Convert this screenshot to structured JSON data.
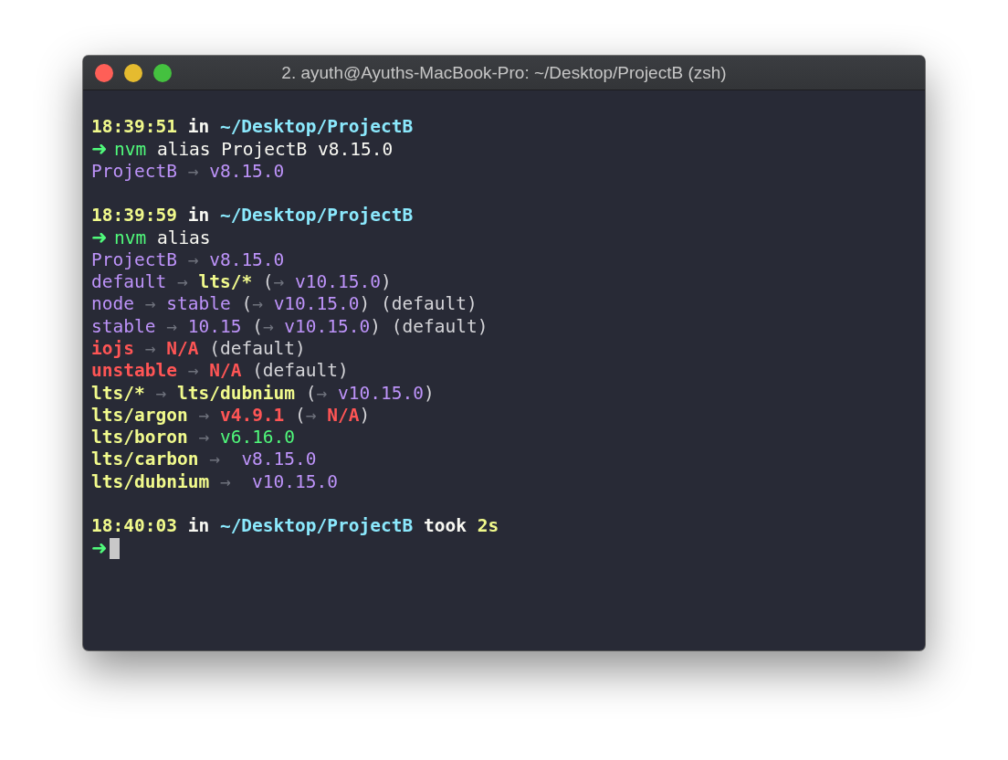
{
  "window": {
    "title": "2. ayuth@Ayuths-MacBook-Pro: ~/Desktop/ProjectB (zsh)"
  },
  "blocks": [
    {
      "lines": [
        [
          {
            "text": "18:39:51",
            "kind": "time"
          },
          {
            "text": " in ",
            "kind": "bold"
          },
          {
            "text": "~/Desktop/ProjectB",
            "kind": "path"
          }
        ],
        [
          {
            "text": "➜ ",
            "kind": "prompt"
          },
          {
            "text": "nvm",
            "kind": "cmd"
          },
          {
            "text": " alias ProjectB v8.15.0",
            "kind": "plain"
          }
        ],
        [
          {
            "text": "ProjectB",
            "kind": "alias"
          },
          {
            "text": " → ",
            "kind": "arrow"
          },
          {
            "text": "v8.15.0",
            "kind": "alias"
          }
        ]
      ]
    },
    {
      "lines": [
        [
          {
            "text": "18:39:59",
            "kind": "time"
          },
          {
            "text": " in ",
            "kind": "bold"
          },
          {
            "text": "~/Desktop/ProjectB",
            "kind": "path"
          }
        ],
        [
          {
            "text": "➜ ",
            "kind": "prompt"
          },
          {
            "text": "nvm",
            "kind": "cmd"
          },
          {
            "text": " alias",
            "kind": "plain"
          }
        ],
        [
          {
            "text": "ProjectB",
            "kind": "alias"
          },
          {
            "text": " → ",
            "kind": "arrow"
          },
          {
            "text": "v8.15.0",
            "kind": "alias"
          }
        ],
        [
          {
            "text": "default",
            "kind": "alias"
          },
          {
            "text": " → ",
            "kind": "arrow"
          },
          {
            "text": "lts/*",
            "kind": "lts"
          },
          {
            "text": " (",
            "kind": "muted"
          },
          {
            "text": "→ ",
            "kind": "arrow"
          },
          {
            "text": "v10.15.0",
            "kind": "alias"
          },
          {
            "text": ")",
            "kind": "muted"
          }
        ],
        [
          {
            "text": "node",
            "kind": "alias"
          },
          {
            "text": " → ",
            "kind": "arrow"
          },
          {
            "text": "stable",
            "kind": "alias"
          },
          {
            "text": " (",
            "kind": "muted"
          },
          {
            "text": "→ ",
            "kind": "arrow"
          },
          {
            "text": "v10.15.0",
            "kind": "alias"
          },
          {
            "text": ") (default)",
            "kind": "muted"
          }
        ],
        [
          {
            "text": "stable",
            "kind": "alias"
          },
          {
            "text": " → ",
            "kind": "arrow"
          },
          {
            "text": "10.15",
            "kind": "alias"
          },
          {
            "text": " (",
            "kind": "muted"
          },
          {
            "text": "→ ",
            "kind": "arrow"
          },
          {
            "text": "v10.15.0",
            "kind": "alias"
          },
          {
            "text": ") (default)",
            "kind": "muted"
          }
        ],
        [
          {
            "text": "iojs",
            "kind": "na"
          },
          {
            "text": " → ",
            "kind": "arrow"
          },
          {
            "text": "N/A",
            "kind": "na"
          },
          {
            "text": " (default)",
            "kind": "muted"
          }
        ],
        [
          {
            "text": "unstable",
            "kind": "na"
          },
          {
            "text": " → ",
            "kind": "arrow"
          },
          {
            "text": "N/A",
            "kind": "na"
          },
          {
            "text": " (default)",
            "kind": "muted"
          }
        ],
        [
          {
            "text": "lts/*",
            "kind": "lts"
          },
          {
            "text": " → ",
            "kind": "arrow"
          },
          {
            "text": "lts/dubnium",
            "kind": "lts"
          },
          {
            "text": " (",
            "kind": "muted"
          },
          {
            "text": "→ ",
            "kind": "arrow"
          },
          {
            "text": "v10.15.0",
            "kind": "alias"
          },
          {
            "text": ")",
            "kind": "muted"
          }
        ],
        [
          {
            "text": "lts/argon",
            "kind": "lts"
          },
          {
            "text": " → ",
            "kind": "arrow"
          },
          {
            "text": "v4.9.1",
            "kind": "na"
          },
          {
            "text": " (",
            "kind": "muted"
          },
          {
            "text": "→ ",
            "kind": "arrow"
          },
          {
            "text": "N/A",
            "kind": "na"
          },
          {
            "text": ")",
            "kind": "muted"
          }
        ],
        [
          {
            "text": "lts/boron",
            "kind": "lts"
          },
          {
            "text": " → ",
            "kind": "arrow"
          },
          {
            "text": "v6.16.0",
            "kind": "green"
          }
        ],
        [
          {
            "text": "lts/carbon",
            "kind": "lts"
          },
          {
            "text": " → ",
            "kind": "arrow"
          },
          {
            "text": " v8.15.0",
            "kind": "alias"
          }
        ],
        [
          {
            "text": "lts/dubnium",
            "kind": "lts"
          },
          {
            "text": " → ",
            "kind": "arrow"
          },
          {
            "text": " v10.15.0",
            "kind": "alias"
          }
        ]
      ]
    },
    {
      "lines": [
        [
          {
            "text": "18:40:03",
            "kind": "time"
          },
          {
            "text": " in ",
            "kind": "bold"
          },
          {
            "text": "~/Desktop/ProjectB",
            "kind": "path"
          },
          {
            "text": " took ",
            "kind": "bold"
          },
          {
            "text": "2s",
            "kind": "time"
          }
        ],
        [
          {
            "text": "➜",
            "kind": "prompt"
          }
        ]
      ]
    }
  ],
  "cursor": {
    "visible": true
  }
}
